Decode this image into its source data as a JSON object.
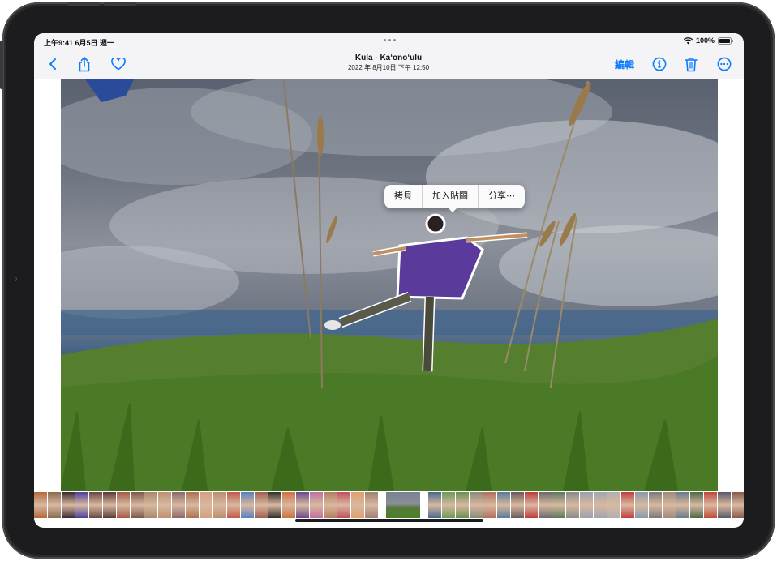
{
  "status_bar": {
    "time_date": "上午9:41   6月5日 週一",
    "battery_percent": "100%"
  },
  "toolbar": {
    "back_icon": "chevron-left-icon",
    "share_icon": "share-icon",
    "favorite_icon": "heart-icon",
    "title": "Kula - Ka‘ono‘ulu",
    "subtitle": "2022 年 8月10日 下午 12:50",
    "edit_label": "編輯",
    "info_icon": "info-circle-icon",
    "delete_icon": "trash-icon",
    "more_icon": "ellipsis-circle-icon"
  },
  "popup_menu": {
    "items": [
      "拷貝",
      "加入貼圖",
      "分享⋯"
    ]
  },
  "colors": {
    "accent": "#0a7aff",
    "toolbar_bg": "#f4f4f6"
  },
  "filmstrip": {
    "thumb_colors": [
      "#b5683c",
      "#8a6a50",
      "#3a2a30",
      "#4c3fa0",
      "#6a4a40",
      "#5a3a3a",
      "#a65a45",
      "#7a5a4a",
      "#a78a6a",
      "#c09070",
      "#8a6a6a",
      "#b07050",
      "#d4a080",
      "#b89070",
      "#c05a4a",
      "#5a80c0",
      "#a06050",
      "#30302a",
      "#d07040",
      "#6a4a8a",
      "#c070a0",
      "#b08060",
      "#c05060",
      "#e0a070",
      "#a08070",
      "#4a6a8a",
      "#6a9a5a",
      "#6a9050",
      "#8a8a7a",
      "#b07060",
      "#5a7a9a",
      "#6a5a5a",
      "#c03a3a",
      "#6a6a6a",
      "#5a7a5a",
      "#8a8a8a",
      "#9aa0b0",
      "#a0a6b0",
      "#b0b0b0",
      "#c04040",
      "#8a9aaa",
      "#7a7a7a",
      "#a08a7a",
      "#6a7a8a",
      "#4a6a4a",
      "#c04a3a",
      "#5a5a6a",
      "#8a5a4a",
      "#3a3a5a",
      "#c07030"
    ]
  }
}
